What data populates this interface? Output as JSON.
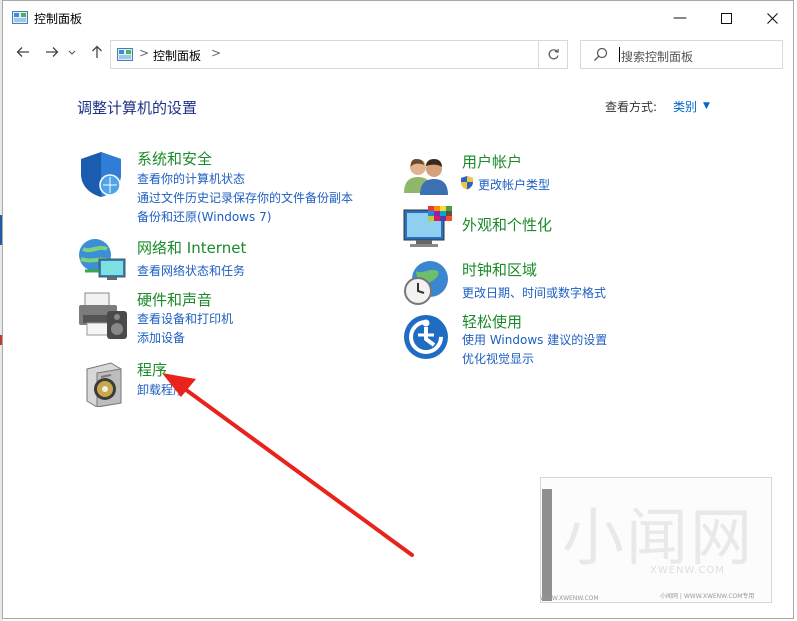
{
  "window": {
    "title": "控制面板",
    "minimize_glyph": "—",
    "maximize_glyph": "☐",
    "close_glyph": "✕"
  },
  "address": {
    "path": "控制面板",
    "separator": ">",
    "search_placeholder": "搜索控制面板"
  },
  "main": {
    "heading": "调整计算机的设置",
    "view_by_label": "查看方式:",
    "view_by_value": "类别"
  },
  "categories_left": [
    {
      "title": "系统和安全",
      "links": [
        "查看你的计算机状态",
        "通过文件历史记录保存你的文件备份副本",
        "备份和还原(Windows 7)"
      ],
      "icon": "shield-icon"
    },
    {
      "title": "网络和 Internet",
      "links": [
        "查看网络状态和任务"
      ],
      "icon": "network-globe-icon"
    },
    {
      "title": "硬件和声音",
      "links": [
        "查看设备和打印机",
        "添加设备"
      ],
      "icon": "printer-speaker-icon"
    },
    {
      "title": "程序",
      "links": [
        "卸载程序"
      ],
      "icon": "programs-disc-icon"
    }
  ],
  "categories_right": [
    {
      "title": "用户帐户",
      "links": [
        "更改帐户类型"
      ],
      "icon": "users-icon"
    },
    {
      "title": "外观和个性化",
      "links": [],
      "icon": "monitor-palette-icon"
    },
    {
      "title": "时钟和区域",
      "links": [
        "更改日期、时间或数字格式"
      ],
      "icon": "clock-globe-icon"
    },
    {
      "title": "轻松使用",
      "links": [
        "使用 Windows 建议的设置",
        "优化视觉显示"
      ],
      "icon": "ease-of-access-icon"
    }
  ],
  "annotation": {
    "arrow_color": "#e8231c"
  },
  "watermark": {
    "big": "小闻网",
    "small": "XWENW.COM",
    "foot": "小闻网 | WWW.XWENW.COM专用",
    "bottom": "WWW.XWENW.COM"
  },
  "colors": {
    "link": "#1e5fc0",
    "category_title": "#1a8a2a",
    "heading": "#1e3287"
  }
}
